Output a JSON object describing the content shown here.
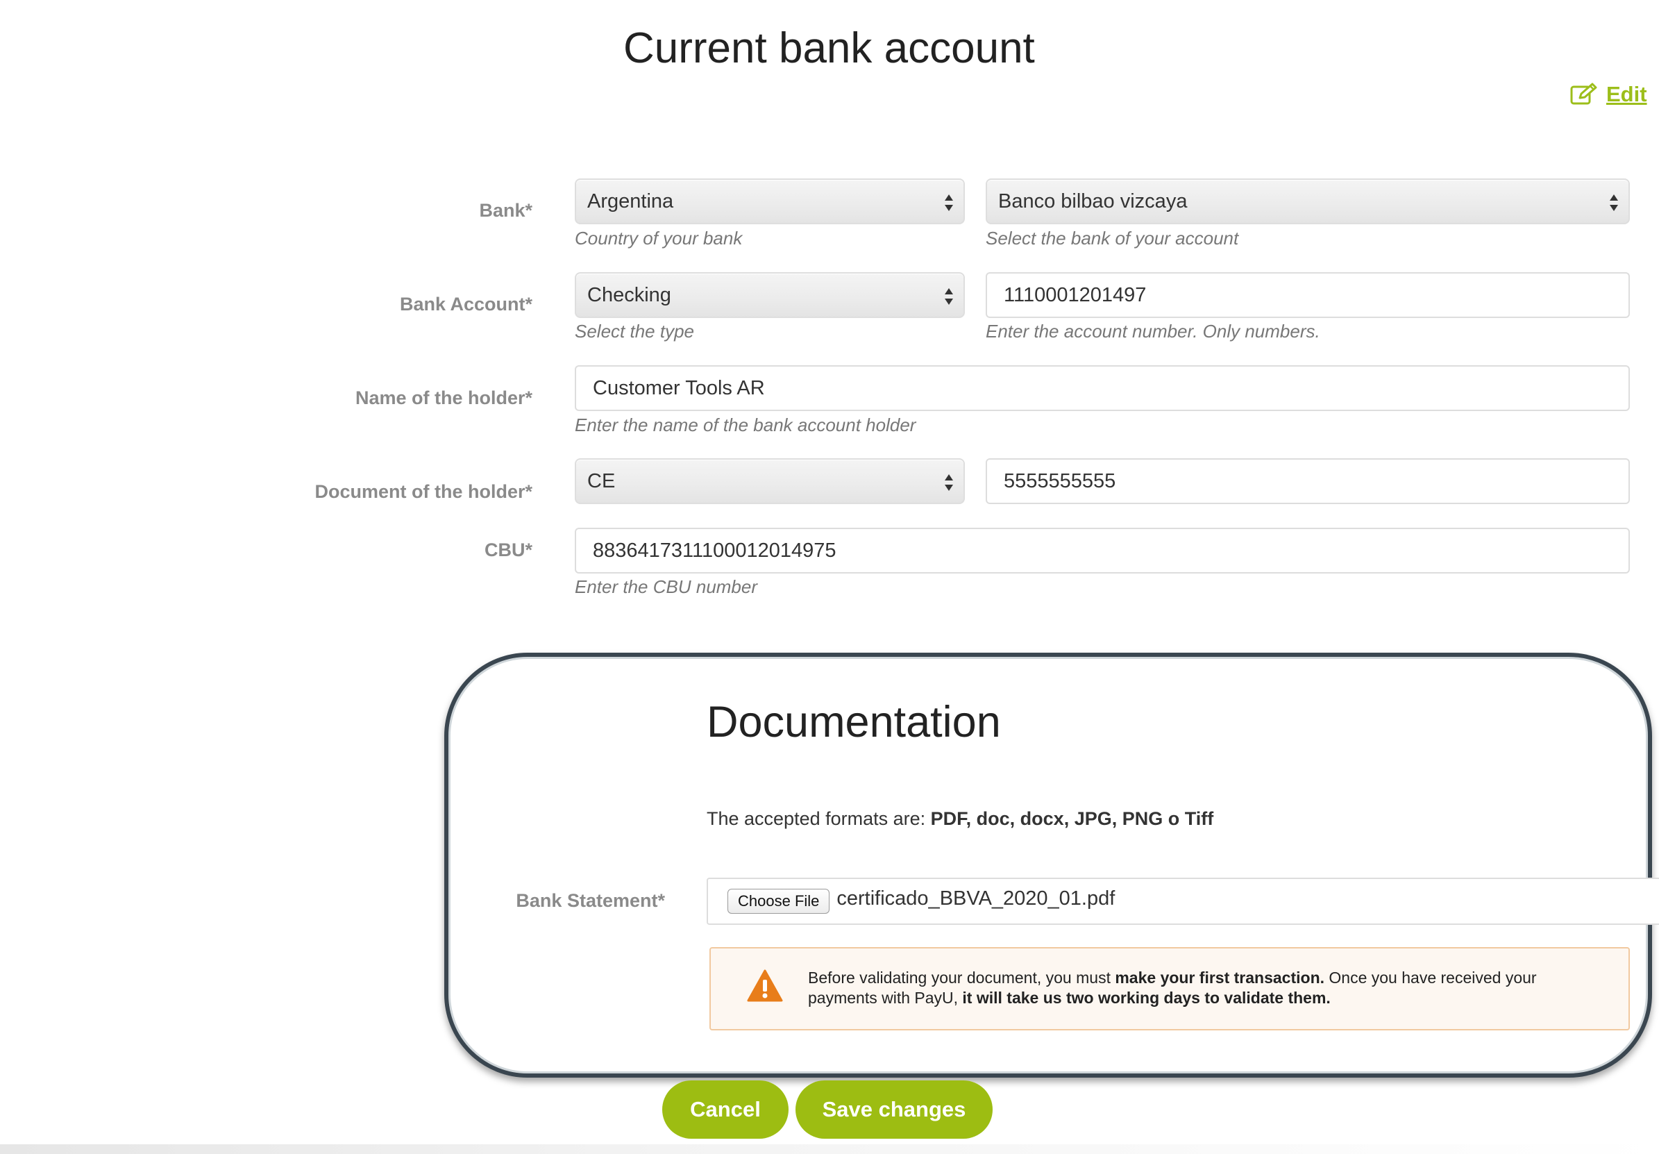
{
  "page": {
    "title": "Current bank account",
    "edit_label": "Edit"
  },
  "form": {
    "bank": {
      "label": "Bank*",
      "country_value": "Argentina",
      "country_hint": "Country of your bank",
      "bank_value": "Banco bilbao vizcaya",
      "bank_hint": "Select the bank of your account"
    },
    "bank_account": {
      "label": "Bank Account*",
      "type_value": "Checking",
      "type_hint": "Select the type",
      "number_value": "1110001201497",
      "number_hint": "Enter the account number. Only numbers."
    },
    "holder_name": {
      "label": "Name of the holder*",
      "value": "Customer Tools AR",
      "hint": "Enter the name of the bank account holder"
    },
    "holder_document": {
      "label": "Document of the holder*",
      "type_value": "CE",
      "number_value": "5555555555"
    },
    "cbu": {
      "label": "CBU*",
      "value": "883641731110001201497​5",
      "hint": "Enter the CBU number"
    }
  },
  "documentation": {
    "title": "Documentation",
    "formats_prefix": "The accepted formats are: ",
    "formats_list": "PDF, doc, docx, JPG, PNG o Tiff",
    "bank_statement_label": "Bank Statement*",
    "choose_file_label": "Choose File",
    "file_name": "certificado_BBVA_2020_01.pdf",
    "warning": {
      "part1": "Before validating your document, you must ",
      "part2_bold": "make your first transaction.",
      "part3": " Once you have received your payments with PayU, ",
      "part4_bold": "it will take us two working days to validate them."
    }
  },
  "actions": {
    "cancel_label": "Cancel",
    "save_label": "Save changes"
  },
  "colors": {
    "accent_green": "#9dbd12",
    "link_green": "#9cbe1a",
    "warning_orange": "#e87d1a",
    "panel_border": "#3a4650"
  },
  "icons": {
    "edit": "edit-pencil-icon",
    "warning": "warning-triangle-icon",
    "select_arrows": "select-arrows-icon"
  }
}
